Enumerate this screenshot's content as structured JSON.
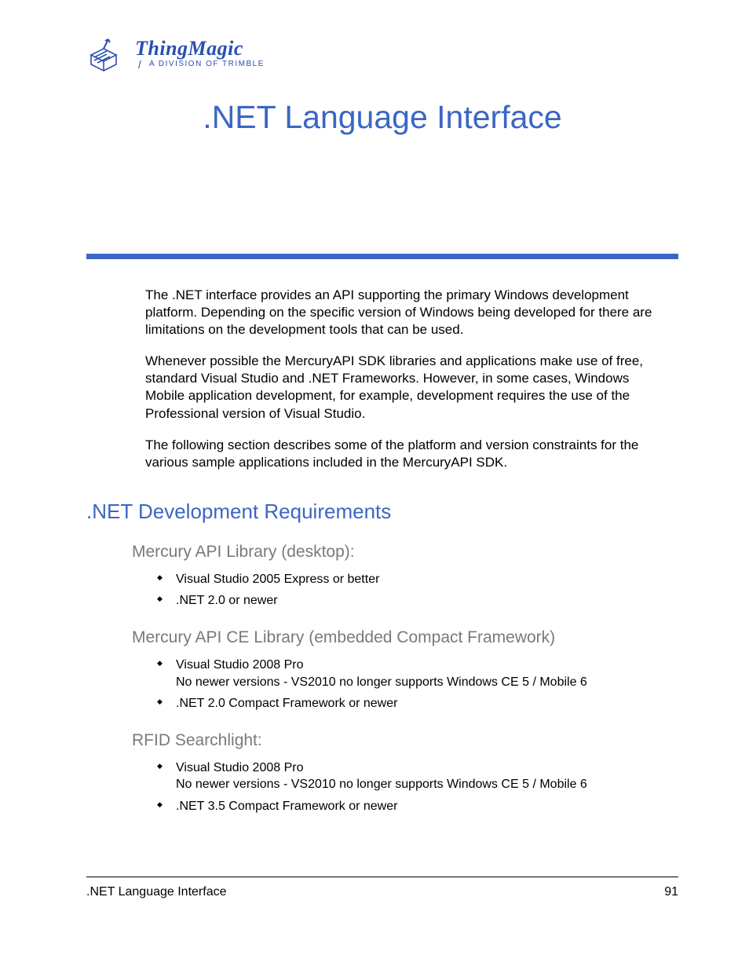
{
  "logo": {
    "title": "ThingMagic",
    "subtitle": "A DIVISION OF TRIMBLE"
  },
  "page_title": ".NET Language Interface",
  "intro": {
    "p1": "The .NET interface provides an API supporting the primary Windows development platform. Depending on the specific version of Windows being developed for there are limitations on the development tools that can be used.",
    "p2": "Whenever possible the MercuryAPI SDK libraries and applications make use of free, standard Visual Studio and .NET Frameworks. However, in some cases, Windows Mobile application development, for example, development requires the use of the Professional version of Visual Studio.",
    "p3": "The following section describes some of the platform and version constraints for the various sample applications included in the MercuryAPI SDK."
  },
  "section_heading": ".NET Development Requirements",
  "groups": [
    {
      "heading": "Mercury API Library (desktop):",
      "items": [
        {
          "main": "Visual Studio 2005 Express or better",
          "note": ""
        },
        {
          "main": ".NET 2.0 or newer",
          "note": ""
        }
      ]
    },
    {
      "heading": "Mercury API CE Library (embedded Compact Framework)",
      "items": [
        {
          "main": "Visual Studio 2008 Pro",
          "note": "No newer versions - VS2010 no longer supports Windows CE 5 / Mobile 6"
        },
        {
          "main": ".NET 2.0 Compact Framework or newer",
          "note": ""
        }
      ]
    },
    {
      "heading": "RFID Searchlight:",
      "items": [
        {
          "main": "Visual Studio 2008 Pro",
          "note": "No newer versions - VS2010 no longer supports Windows CE 5 / Mobile 6"
        },
        {
          "main": ".NET 3.5 Compact Framework or newer",
          "note": ""
        }
      ]
    }
  ],
  "footer": {
    "left": ".NET Language Interface",
    "right": "91"
  }
}
